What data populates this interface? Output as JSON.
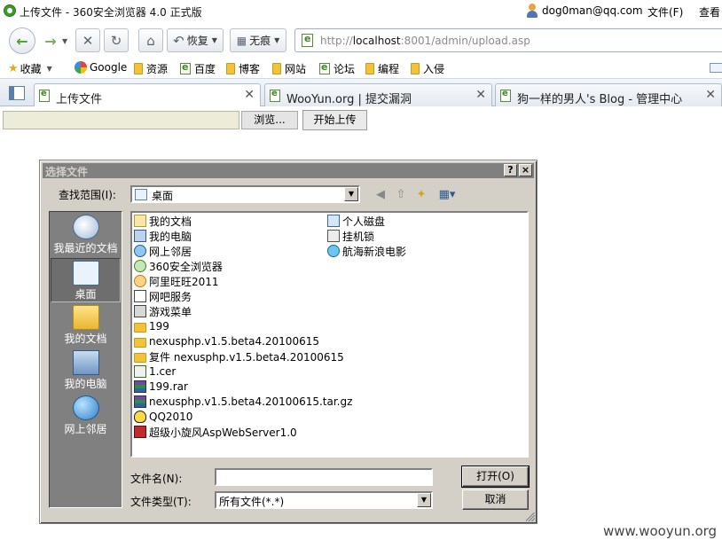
{
  "window": {
    "title": "上传文件 - 360安全浏览器 4.0 正式版",
    "user": "dog0man@qq.com",
    "menu_file": "文件(F)",
    "menu_view": "查看"
  },
  "toolbar": {
    "back_icon": "back-arrow",
    "forward_icon": "forward-arrow",
    "stop_icon": "close-x",
    "refresh_icon": "refresh",
    "home_icon": "home",
    "restore_label": "恢复",
    "incognito_label": "无痕",
    "address_prefix": "http://",
    "address_host": "localhost",
    "address_rest": ":8001/admin/upload.asp"
  },
  "bookmarks": [
    {
      "label": "收藏",
      "icon": "star"
    },
    {
      "label": "Google",
      "icon": "google"
    },
    {
      "label": "资源",
      "icon": "folder"
    },
    {
      "label": "百度",
      "icon": "ie-page"
    },
    {
      "label": "博客",
      "icon": "folder"
    },
    {
      "label": "网站",
      "icon": "folder"
    },
    {
      "label": "论坛",
      "icon": "ie-page"
    },
    {
      "label": "编程",
      "icon": "folder"
    },
    {
      "label": "入侵",
      "icon": "folder"
    }
  ],
  "tabs": [
    {
      "label": "上传文件",
      "active": true
    },
    {
      "label": "WooYun.org | 提交漏洞",
      "active": false
    },
    {
      "label": "狗一样的男人's Blog - 管理中心",
      "active": false
    }
  ],
  "page": {
    "browse_label": "浏览...",
    "upload_label": "开始上传"
  },
  "dialog": {
    "title": "选择文件",
    "help_btn": "?",
    "close_btn": "×",
    "look_in_label": "查找范围(I):",
    "look_in_value": "桌面",
    "places": [
      {
        "label": "我最近的文档",
        "icon": "recent-docs",
        "selected": false
      },
      {
        "label": "桌面",
        "icon": "desktop",
        "selected": true
      },
      {
        "label": "我的文档",
        "icon": "my-documents",
        "selected": false
      },
      {
        "label": "我的电脑",
        "icon": "my-computer",
        "selected": false
      },
      {
        "label": "网上邻居",
        "icon": "network-places",
        "selected": false
      }
    ],
    "files_col1": [
      {
        "name": "我的文档",
        "icon": "doc"
      },
      {
        "name": "我的电脑",
        "icon": "pc"
      },
      {
        "name": "网上邻居",
        "icon": "net"
      },
      {
        "name": "360安全浏览器",
        "icon": "app360"
      },
      {
        "name": "阿里旺旺2011",
        "icon": "ali"
      },
      {
        "name": "网吧服务",
        "icon": "web"
      },
      {
        "name": "游戏菜单",
        "icon": "game"
      },
      {
        "name": "199",
        "icon": "folder"
      },
      {
        "name": "nexusphp.v1.5.beta4.20100615",
        "icon": "folder"
      },
      {
        "name": "复件 nexusphp.v1.5.beta4.20100615",
        "icon": "folder"
      },
      {
        "name": "1.cer",
        "icon": "cert"
      },
      {
        "name": "199.rar",
        "icon": "rar"
      },
      {
        "name": "nexusphp.v1.5.beta4.20100615.tar.gz",
        "icon": "rar"
      },
      {
        "name": "QQ2010",
        "icon": "qq"
      },
      {
        "name": "超级小旋风AspWebServer1.0",
        "icon": "server"
      }
    ],
    "files_col2": [
      {
        "name": "个人磁盘",
        "icon": "disk"
      },
      {
        "name": "挂机锁",
        "icon": "lock"
      },
      {
        "name": "航海新浪电影",
        "icon": "movie"
      }
    ],
    "filename_label": "文件名(N):",
    "filename_value": "",
    "filetype_label": "文件类型(T):",
    "filetype_value": "所有文件(*.*)",
    "open_btn": "打开(O)",
    "cancel_btn": "取消"
  },
  "watermark": "www.wooyun.org"
}
